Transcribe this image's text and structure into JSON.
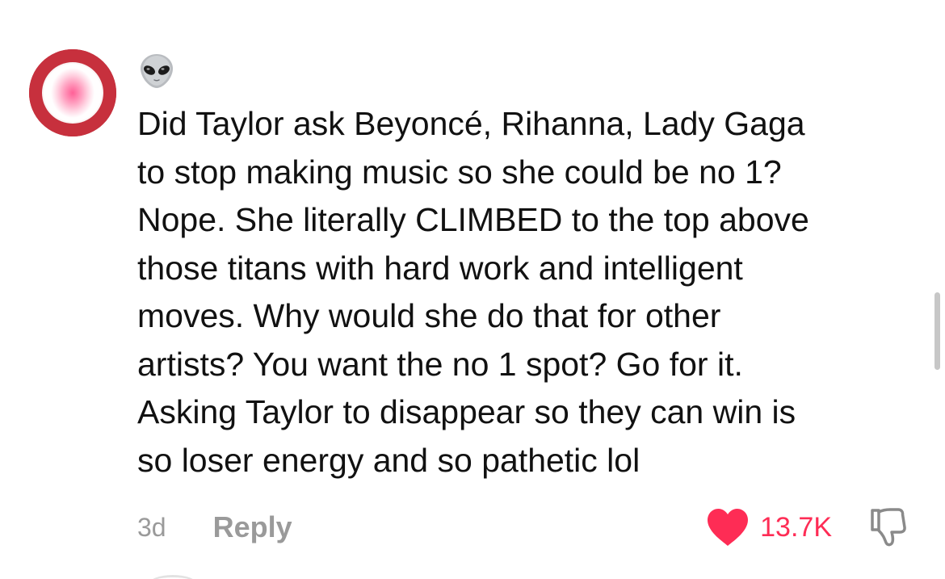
{
  "comment": {
    "username_emoji": "👽",
    "text": "Did Taylor ask Beyoncé, Rihanna, Lady Gaga\nto stop making music so she could be no 1?\nNope. She literally CLIMBED to the top above\nthose titans with hard work and intelligent\nmoves. Why would she do that for other\nartists? You want the no 1 spot? Go for it.\nAsking Taylor to disappear so they can win is\nso loser energy and so pathetic lol",
    "timestamp": "3d",
    "reply_label": "Reply",
    "like_count": "13.7K",
    "liked": true
  },
  "colors": {
    "like_accent": "#fe2c55",
    "meta_gray": "#9a9a9a",
    "text": "#111111"
  },
  "icons": {
    "like": "heart-icon",
    "dislike": "thumbs-down-icon",
    "username": "alien-emoji-icon"
  }
}
